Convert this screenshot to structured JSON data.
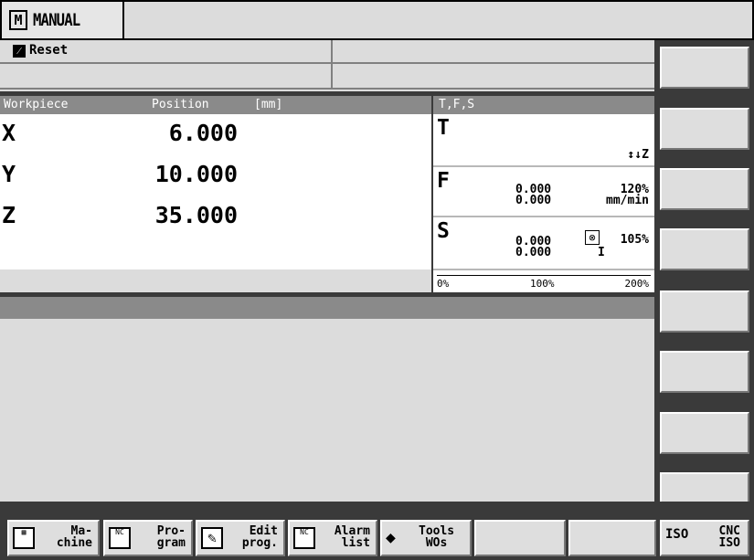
{
  "mode": {
    "icon": "M",
    "title": "MANUAL"
  },
  "status": {
    "reset_label": "Reset",
    "reset_icon": "slash-icon"
  },
  "workpiece": {
    "header_left": "Workpiece",
    "header_mid": "Position",
    "header_unit": "[mm]",
    "axes": [
      {
        "name": "X",
        "value": "6.000"
      },
      {
        "name": "Y",
        "value": "10.000"
      },
      {
        "name": "Z",
        "value": "35.000"
      }
    ]
  },
  "tfs": {
    "header": "T,F,S",
    "t": {
      "letter": "T",
      "tool_dir": "↕↓Z"
    },
    "f": {
      "letter": "F",
      "val1": "0.000",
      "val2": "0.000",
      "pct": "120%",
      "unit": "mm/min"
    },
    "s": {
      "letter": "S",
      "val1": "0.000",
      "val2": "0.000",
      "pct": "105%",
      "gear": "I"
    },
    "scale": [
      "0%",
      "100%",
      "200%"
    ]
  },
  "softkeys_bottom": [
    {
      "line1": "Ma-",
      "line2": "chine",
      "icon": "machine-icon"
    },
    {
      "line1": "Pro-",
      "line2": "gram",
      "icon": "nc-program-icon"
    },
    {
      "line1": "Edit",
      "line2": "prog.",
      "icon": "edit-icon"
    },
    {
      "line1": "Alarm",
      "line2": "list",
      "icon": "nc-alarm-icon"
    },
    {
      "line1": "Tools",
      "line2": "WOs",
      "icon": "tools-icon"
    },
    {
      "line1": "",
      "line2": "",
      "icon": ""
    },
    {
      "line1": "",
      "line2": "",
      "icon": ""
    },
    {
      "line1": "CNC",
      "line2": "ISO",
      "icon": "iso-icon"
    }
  ]
}
